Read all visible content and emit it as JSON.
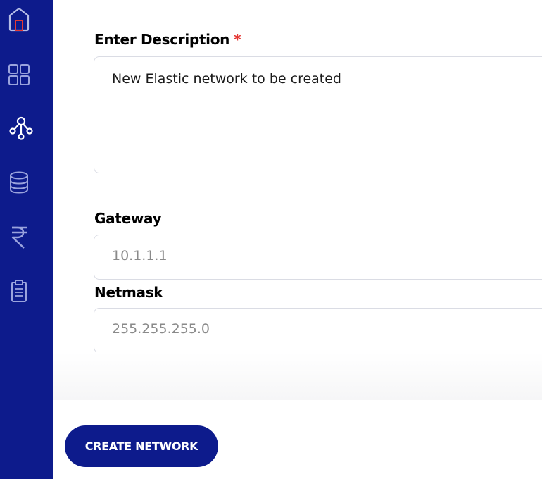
{
  "sidebar": {
    "icons": [
      "home-icon",
      "dashboard-grid-icon",
      "network-icon",
      "database-icon",
      "rupee-icon",
      "clipboard-icon"
    ]
  },
  "form": {
    "description": {
      "label": "Enter Description",
      "required_marker": "*",
      "value": "New Elastic network to be created"
    },
    "gateway": {
      "label": "Gateway",
      "placeholder": "10.1.1.1"
    },
    "netmask": {
      "label": "Netmask",
      "placeholder": "255.255.255.0"
    }
  },
  "actions": {
    "create_label": "CREATE NETWORK"
  },
  "colors": {
    "sidebar_bg": "#0d1b8c",
    "primary_button": "#0d1b8c",
    "required": "#e53935",
    "icon_stroke": "#9aa3dd",
    "active_icon": "#ffffff"
  }
}
